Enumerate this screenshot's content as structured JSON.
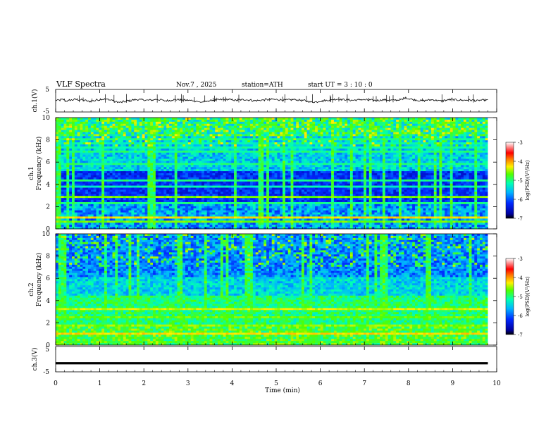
{
  "header": {
    "title": "VLF  Spectra",
    "date": "Nov.7 , 2025",
    "station": "station=ATH",
    "start_ut": "start  UT  =   3  : 10 : 0"
  },
  "chart_data": [
    {
      "type": "line",
      "panel": "ch1-waveform",
      "ylabel": "ch.1(V)",
      "ylim": [
        -5,
        5
      ],
      "ytick_labels": [
        "5",
        "-5"
      ],
      "xlim": [
        0,
        9.8
      ],
      "baseline_v": 0.2,
      "values": [
        0.2,
        0.5,
        -0.1,
        0.3,
        0.6,
        0.4,
        0.1,
        -0.3,
        0.0,
        0.4,
        0.7,
        0.6,
        0.3,
        -0.5,
        -0.7,
        -0.4,
        0.0,
        0.4,
        0.5,
        0.4,
        0.2,
        0.3,
        0.6,
        0.4,
        0.0,
        0.1,
        0.4,
        0.5,
        0.3,
        0.2,
        0.1,
        -0.2,
        -0.6,
        -0.4,
        0.0,
        0.3,
        0.4,
        0.5,
        0.6,
        0.4,
        0.2,
        0.4,
        0.5,
        0.3,
        0.0,
        0.1,
        0.3,
        0.5,
        0.6,
        0.5,
        0.4,
        0.3,
        0.4,
        0.5,
        0.3,
        0.1,
        -0.3,
        -0.6,
        -0.5,
        -0.2,
        0.1,
        0.3,
        0.6,
        0.7,
        0.5,
        0.4,
        0.2,
        0.3,
        0.5,
        0.4,
        0.3,
        0.1,
        0.2,
        0.4,
        0.3,
        0.2,
        0.3,
        0.5,
        1.2,
        0.9,
        0.4,
        0.1,
        0.0,
        0.3,
        0.4,
        0.2,
        -0.1,
        0.2,
        0.5,
        0.4,
        0.3,
        0.2,
        0.3,
        0.2,
        0.0,
        0.2,
        0.3,
        0.1
      ]
    },
    {
      "type": "heatmap",
      "panel": "ch1-spectrogram",
      "ylabel": "ch.1\nFrequency  (kHz)",
      "ylim": [
        0,
        10
      ],
      "ytick_labels": [
        "0",
        "2",
        "4",
        "6",
        "8",
        "10"
      ],
      "xlim": [
        0,
        9.8
      ],
      "colorbar": {
        "label": "log(PSD)(V²/Hz)",
        "range": [
          -7,
          -3
        ],
        "tick_labels": [
          "-3",
          "-4",
          "-5",
          "-6",
          "-7"
        ]
      }
    },
    {
      "type": "heatmap",
      "panel": "ch2-spectrogram",
      "ylabel": "ch.2\nFrequency  (kHz)",
      "ylim": [
        0,
        10
      ],
      "ytick_labels": [
        "0",
        "2",
        "4",
        "6",
        "8",
        "10"
      ],
      "xlim": [
        0,
        9.8
      ],
      "colorbar": {
        "label": "log(PSD)(V²/Hz)",
        "range": [
          -7,
          -3
        ],
        "tick_labels": [
          "-3",
          "-4",
          "-5",
          "-6",
          "-7"
        ]
      }
    },
    {
      "type": "line",
      "panel": "ch3-waveform",
      "ylabel": "ch.3(V)",
      "ylim": [
        -5,
        5
      ],
      "ytick_labels": [
        "5",
        "-5"
      ],
      "xlim": [
        0,
        9.8
      ],
      "values": [
        -1.6,
        -1.6
      ]
    }
  ],
  "x_axis": {
    "label": "Time  (min)",
    "range": [
      0,
      10
    ],
    "tick_labels": [
      "0",
      "1",
      "2",
      "3",
      "4",
      "5",
      "6",
      "7",
      "8",
      "9",
      "10"
    ]
  },
  "colors": {
    "spectrogram_ramp": [
      "#000000",
      "#0000a0",
      "#0028ff",
      "#00b4ff",
      "#00ffb4",
      "#50ff00",
      "#fff000",
      "#ff7800",
      "#ff0000",
      "#ff9090",
      "#ffffff"
    ]
  }
}
